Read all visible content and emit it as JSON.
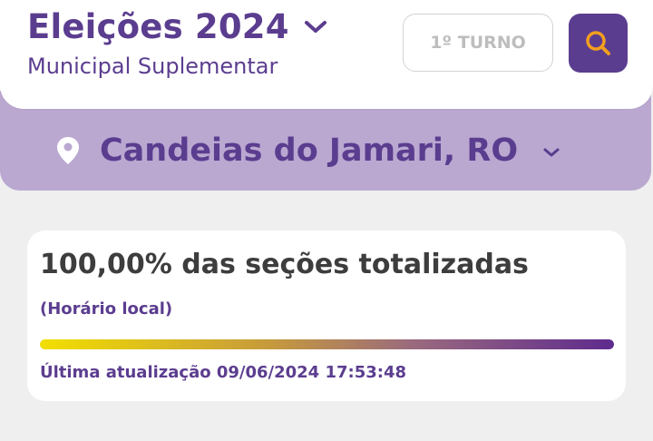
{
  "header": {
    "title": "Eleições 2024",
    "subtitle": "Municipal Suplementar",
    "round_label": "1º TURNO",
    "title_chevron_icon": "chevron-down-icon",
    "search_icon": "search-icon"
  },
  "location": {
    "name": "Candeias do Jamari, RO",
    "pin_icon": "map-pin-icon",
    "chevron_icon": "chevron-down-icon"
  },
  "status_card": {
    "headline": "100,00% das seções totalizadas",
    "note": "(Horário local)",
    "progress_fraction": 1.0,
    "last_update": "Última atualização 09/06/2024 17:53:48"
  },
  "colors": {
    "brand_purple": "#5b3d8f",
    "band_lavender": "#baa8d1",
    "search_icon_orange": "#f29f1f",
    "progress_gradient_start": "#f2df00",
    "progress_gradient_end": "#5e2a8e",
    "background": "#efefef"
  }
}
